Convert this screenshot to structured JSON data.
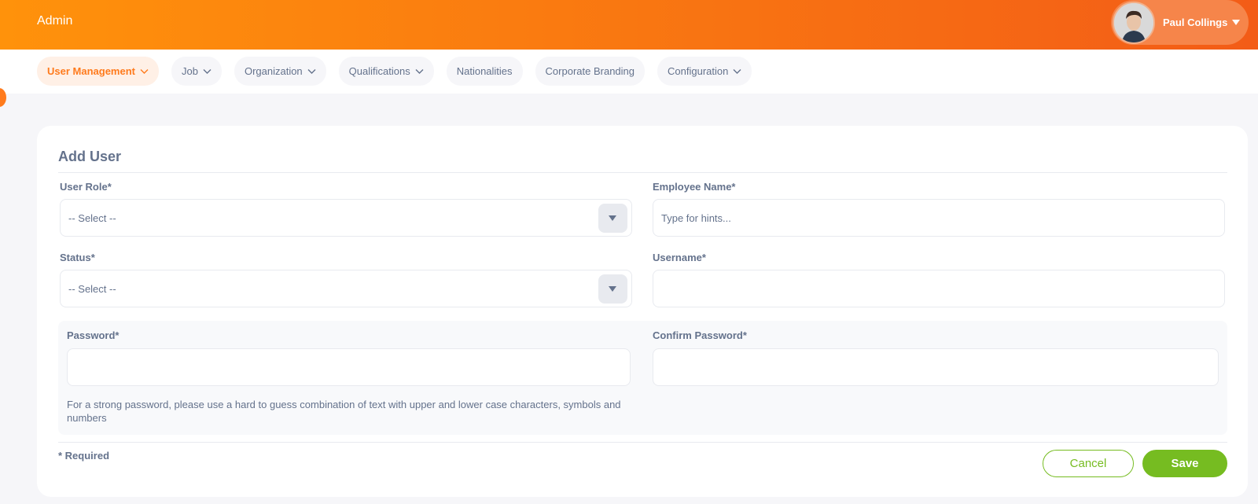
{
  "header": {
    "module_title": "Admin",
    "user_name": "Paul Collings"
  },
  "nav": {
    "items": [
      {
        "label": "User Management",
        "has_dropdown": true,
        "active": true
      },
      {
        "label": "Job",
        "has_dropdown": true
      },
      {
        "label": "Organization",
        "has_dropdown": true
      },
      {
        "label": "Qualifications",
        "has_dropdown": true
      },
      {
        "label": "Nationalities",
        "has_dropdown": false
      },
      {
        "label": "Corporate Branding",
        "has_dropdown": false
      },
      {
        "label": "Configuration",
        "has_dropdown": true
      }
    ]
  },
  "form": {
    "title": "Add User",
    "user_role": {
      "label": "User Role*",
      "value": "-- Select --"
    },
    "employee_name": {
      "label": "Employee Name*",
      "placeholder": "Type for hints..."
    },
    "status": {
      "label": "Status*",
      "value": "-- Select --"
    },
    "username": {
      "label": "Username*",
      "value": ""
    },
    "password": {
      "label": "Password*",
      "value": ""
    },
    "confirm_password": {
      "label": "Confirm Password*",
      "value": ""
    },
    "password_hint": "For a strong password, please use a hard to guess combination of text with upper and lower case characters, symbols and numbers",
    "required_note": "* Required",
    "cancel_label": "Cancel",
    "save_label": "Save"
  },
  "colors": {
    "header_gradient_start": "#ff920b",
    "header_gradient_end": "#f35c17",
    "accent_orange": "#ff7b1d",
    "primary_green": "#76bc21",
    "text": "#64728c",
    "background": "#f6f6f9"
  }
}
